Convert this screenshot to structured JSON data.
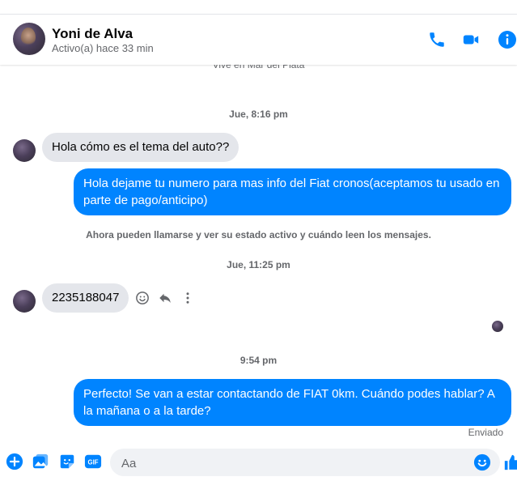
{
  "header": {
    "name": "Yoni de Alva",
    "status": "Activo(a) hace 33 min"
  },
  "conversation": {
    "clipped_line": "Vive en Mar del Plata",
    "timestamp_1": "Jue, 8:16 pm",
    "msg_1": "Hola cómo es el tema del auto??",
    "msg_2": "Hola dejame tu numero para mas info del Fiat cronos(aceptamos tu usado en parte de pago/anticipo)",
    "system_note": "Ahora pueden llamarse y ver su estado activo y cuándo leen los mensajes.",
    "timestamp_2": "Jue, 11:25 pm",
    "msg_3": "2235188047",
    "timestamp_3": "9:54 pm",
    "msg_4": "Perfecto!  Se van a estar contactando de FIAT 0km. Cuándo podes hablar? A la mañana o a la tarde?",
    "sent_status": "Enviado"
  },
  "composer": {
    "placeholder": "Aa"
  },
  "icons": {
    "header": [
      "phone-icon",
      "video-icon",
      "info-icon"
    ],
    "message_actions": [
      "emoji-reaction-icon",
      "reply-icon",
      "more-options-icon"
    ],
    "composer": [
      "plus-icon",
      "photo-icon",
      "sticker-icon",
      "gif-icon",
      "emoji-icon",
      "thumbs-up-icon"
    ]
  },
  "colors": {
    "accent": "#0084ff",
    "incoming_bubble": "#e4e6eb",
    "muted_text": "#65676b"
  }
}
